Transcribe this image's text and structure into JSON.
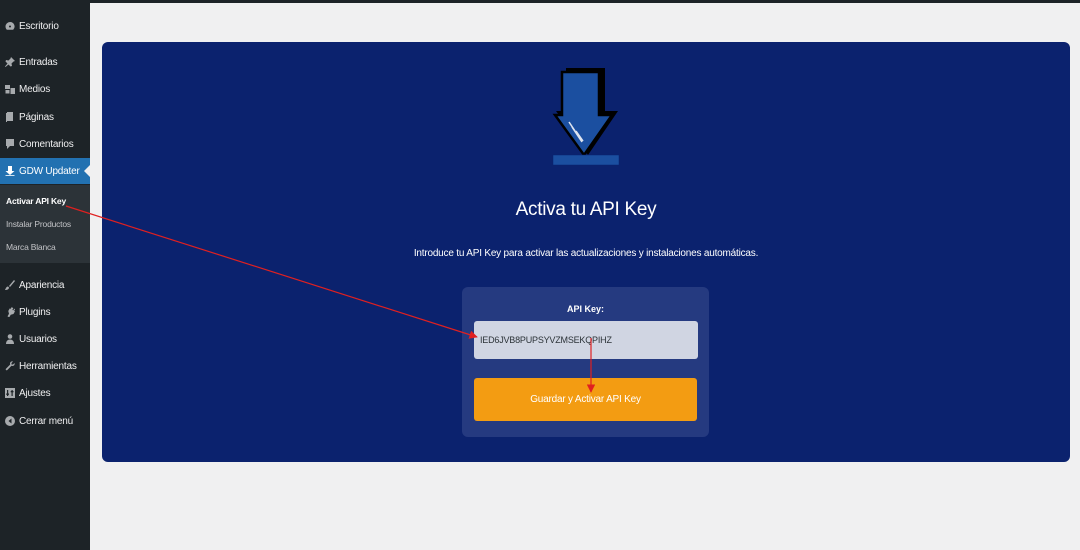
{
  "sidebar": {
    "items": [
      {
        "label": "Escritorio",
        "icon": "dashboard-icon"
      },
      {
        "label": "Entradas",
        "icon": "pin-icon"
      },
      {
        "label": "Medios",
        "icon": "media-icon"
      },
      {
        "label": "Páginas",
        "icon": "pages-icon"
      },
      {
        "label": "Comentarios",
        "icon": "comment-icon"
      },
      {
        "label": "GDW Updater",
        "icon": "download-icon"
      },
      {
        "label": "Apariencia",
        "icon": "brush-icon"
      },
      {
        "label": "Plugins",
        "icon": "plugin-icon"
      },
      {
        "label": "Usuarios",
        "icon": "user-icon"
      },
      {
        "label": "Herramientas",
        "icon": "wrench-icon"
      },
      {
        "label": "Ajustes",
        "icon": "settings-icon"
      },
      {
        "label": "Cerrar menú",
        "icon": "collapse-icon"
      }
    ],
    "submenu": [
      "Activar API Key",
      "Instalar Productos",
      "Marca Blanca"
    ]
  },
  "main": {
    "title": "Activa tu API Key",
    "intro": "Introduce tu API Key para activar las actualizaciones y instalaciones automáticas.",
    "api_label": "API Key:",
    "api_value": "IED6JVB8PUPSYVZMSEKQPIHZ",
    "save_label": "Guardar y Activar API Key"
  },
  "colors": {
    "sidebar_bg": "#1d2327",
    "active_item": "#2271b1",
    "panel_bg": "#0b226e",
    "form_box": "#253a80",
    "button": "#f39c12",
    "annotation_arrow": "#e02020"
  }
}
